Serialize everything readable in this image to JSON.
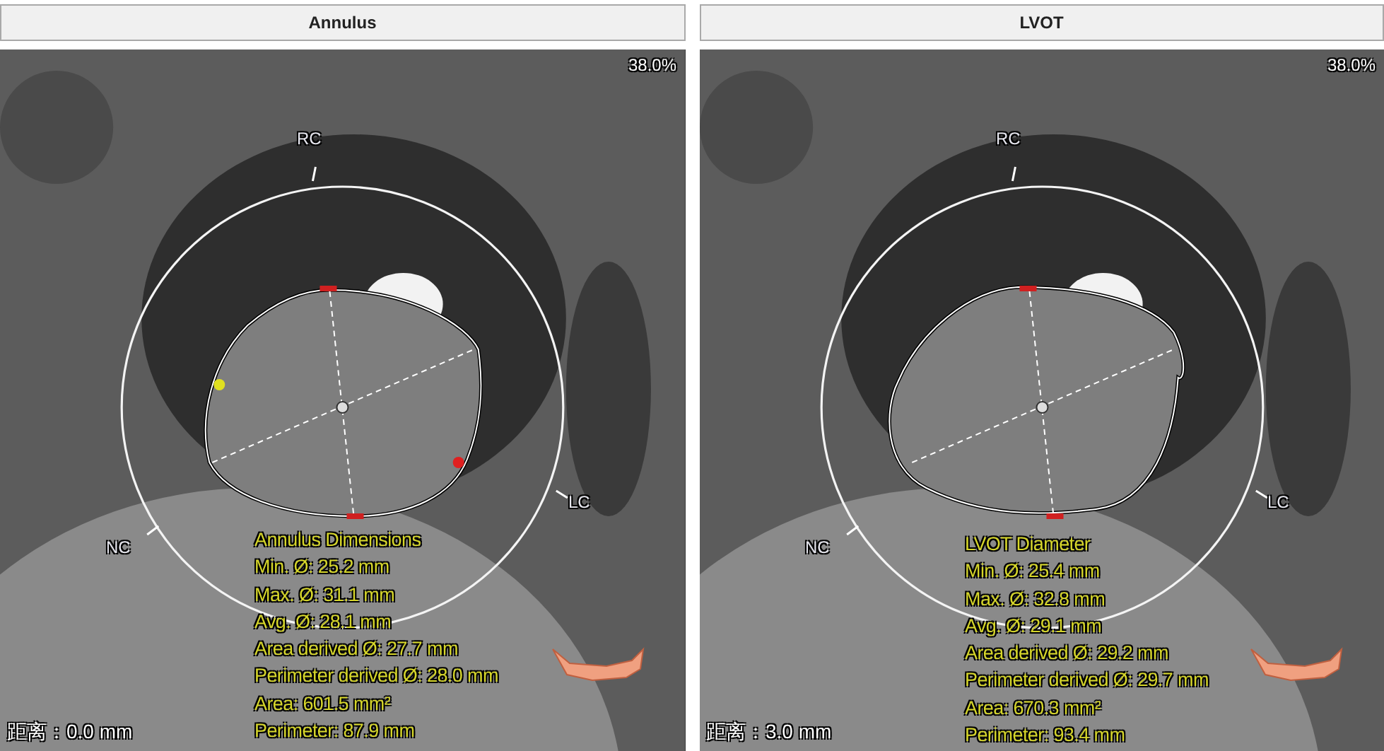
{
  "panels": [
    {
      "title": "Annulus",
      "zoom": "38.0%",
      "cusps": {
        "top": "RC",
        "right": "LC",
        "left": "NC"
      },
      "measure_title": "Annulus Dimensions",
      "measurements": [
        "Min. Ø: 25.2 mm",
        "Max. Ø: 31.1 mm",
        "Avg. Ø: 28.1 mm",
        "Area derived Ø: 27.7 mm",
        "Perimeter derived Ø: 28.0 mm",
        "Area: 601.5 mm²",
        "Perimeter: 87.9 mm"
      ],
      "distance": "距离：0.0 mm"
    },
    {
      "title": "LVOT",
      "zoom": "38.0%",
      "cusps": {
        "top": "RC",
        "right": "LC",
        "left": "NC"
      },
      "measure_title": "LVOT Diameter",
      "measurements": [
        "Min. Ø: 25.4 mm",
        "Max. Ø: 32.8 mm",
        "Avg. Ø: 29.1 mm",
        "Area derived Ø: 29.2 mm",
        "Perimeter derived Ø: 29.7 mm",
        "Area: 670.3 mm²",
        "Perimeter: 93.4 mm"
      ],
      "distance": "距离：3.0 mm"
    }
  ]
}
